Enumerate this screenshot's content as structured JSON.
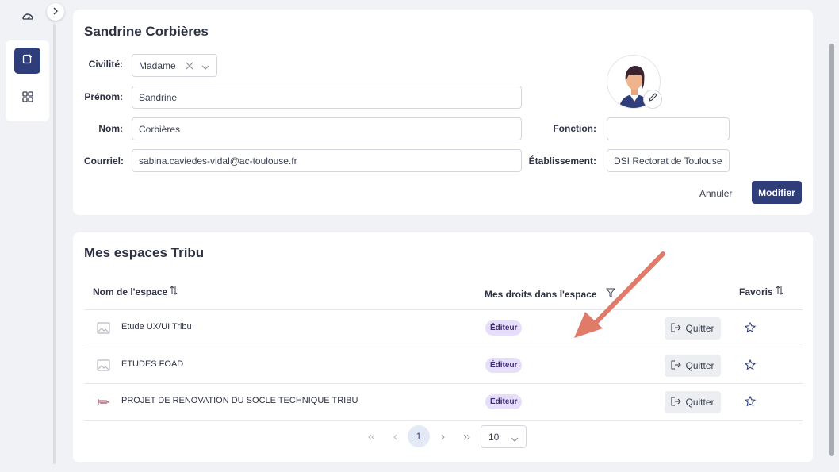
{
  "profile": {
    "title": "Sandrine Corbières",
    "civility_label": "Civilité:",
    "civility_value": "Madame",
    "firstname_label": "Prénom:",
    "firstname_value": "Sandrine",
    "lastname_label": "Nom:",
    "lastname_value": "Corbières",
    "email_label": "Courriel:",
    "email_value": "sabina.caviedes-vidal@ac-toulouse.fr",
    "function_label": "Fonction:",
    "function_value": "",
    "establishment_label": "Établissement:",
    "establishment_value": "DSI Rectorat de Toulouse",
    "cancel_label": "Annuler",
    "submit_label": "Modifier"
  },
  "spaces": {
    "title": "Mes espaces Tribu",
    "columns": {
      "name": "Nom de l'espace",
      "rights": "Mes droits dans l'espace",
      "favorites": "Favoris"
    },
    "rows": [
      {
        "name": "Etude UX/UI Tribu",
        "right": "Éditeur",
        "action": "Quitter",
        "icon": "image-placeholder-icon"
      },
      {
        "name": "ETUDES FOAD",
        "right": "Éditeur",
        "action": "Quitter",
        "icon": "image-placeholder-icon"
      },
      {
        "name": "PROJET DE RENOVATION DU SOCLE TECHNIQUE TRIBU",
        "right": "Éditeur",
        "action": "Quitter",
        "icon": "space-logo-icon"
      }
    ],
    "pagination": {
      "current_page": "1",
      "page_size": "10"
    }
  },
  "colors": {
    "primary": "#2f3d7a",
    "badge_bg": "#e6defa",
    "annotation_arrow": "#e07b6a"
  }
}
